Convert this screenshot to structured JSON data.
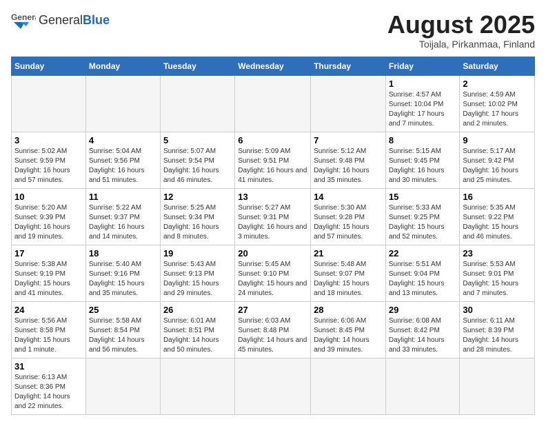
{
  "header": {
    "logo_general": "General",
    "logo_blue": "Blue",
    "month_title": "August 2025",
    "location": "Toijala, Pirkanmaa, Finland"
  },
  "weekdays": [
    "Sunday",
    "Monday",
    "Tuesday",
    "Wednesday",
    "Thursday",
    "Friday",
    "Saturday"
  ],
  "weeks": [
    [
      {
        "day": "",
        "info": ""
      },
      {
        "day": "",
        "info": ""
      },
      {
        "day": "",
        "info": ""
      },
      {
        "day": "",
        "info": ""
      },
      {
        "day": "",
        "info": ""
      },
      {
        "day": "1",
        "info": "Sunrise: 4:57 AM\nSunset: 10:04 PM\nDaylight: 17 hours and 7 minutes."
      },
      {
        "day": "2",
        "info": "Sunrise: 4:59 AM\nSunset: 10:02 PM\nDaylight: 17 hours and 2 minutes."
      }
    ],
    [
      {
        "day": "3",
        "info": "Sunrise: 5:02 AM\nSunset: 9:59 PM\nDaylight: 16 hours and 57 minutes."
      },
      {
        "day": "4",
        "info": "Sunrise: 5:04 AM\nSunset: 9:56 PM\nDaylight: 16 hours and 51 minutes."
      },
      {
        "day": "5",
        "info": "Sunrise: 5:07 AM\nSunset: 9:54 PM\nDaylight: 16 hours and 46 minutes."
      },
      {
        "day": "6",
        "info": "Sunrise: 5:09 AM\nSunset: 9:51 PM\nDaylight: 16 hours and 41 minutes."
      },
      {
        "day": "7",
        "info": "Sunrise: 5:12 AM\nSunset: 9:48 PM\nDaylight: 16 hours and 35 minutes."
      },
      {
        "day": "8",
        "info": "Sunrise: 5:15 AM\nSunset: 9:45 PM\nDaylight: 16 hours and 30 minutes."
      },
      {
        "day": "9",
        "info": "Sunrise: 5:17 AM\nSunset: 9:42 PM\nDaylight: 16 hours and 25 minutes."
      }
    ],
    [
      {
        "day": "10",
        "info": "Sunrise: 5:20 AM\nSunset: 9:39 PM\nDaylight: 16 hours and 19 minutes."
      },
      {
        "day": "11",
        "info": "Sunrise: 5:22 AM\nSunset: 9:37 PM\nDaylight: 16 hours and 14 minutes."
      },
      {
        "day": "12",
        "info": "Sunrise: 5:25 AM\nSunset: 9:34 PM\nDaylight: 16 hours and 8 minutes."
      },
      {
        "day": "13",
        "info": "Sunrise: 5:27 AM\nSunset: 9:31 PM\nDaylight: 16 hours and 3 minutes."
      },
      {
        "day": "14",
        "info": "Sunrise: 5:30 AM\nSunset: 9:28 PM\nDaylight: 15 hours and 57 minutes."
      },
      {
        "day": "15",
        "info": "Sunrise: 5:33 AM\nSunset: 9:25 PM\nDaylight: 15 hours and 52 minutes."
      },
      {
        "day": "16",
        "info": "Sunrise: 5:35 AM\nSunset: 9:22 PM\nDaylight: 15 hours and 46 minutes."
      }
    ],
    [
      {
        "day": "17",
        "info": "Sunrise: 5:38 AM\nSunset: 9:19 PM\nDaylight: 15 hours and 41 minutes."
      },
      {
        "day": "18",
        "info": "Sunrise: 5:40 AM\nSunset: 9:16 PM\nDaylight: 15 hours and 35 minutes."
      },
      {
        "day": "19",
        "info": "Sunrise: 5:43 AM\nSunset: 9:13 PM\nDaylight: 15 hours and 29 minutes."
      },
      {
        "day": "20",
        "info": "Sunrise: 5:45 AM\nSunset: 9:10 PM\nDaylight: 15 hours and 24 minutes."
      },
      {
        "day": "21",
        "info": "Sunrise: 5:48 AM\nSunset: 9:07 PM\nDaylight: 15 hours and 18 minutes."
      },
      {
        "day": "22",
        "info": "Sunrise: 5:51 AM\nSunset: 9:04 PM\nDaylight: 15 hours and 13 minutes."
      },
      {
        "day": "23",
        "info": "Sunrise: 5:53 AM\nSunset: 9:01 PM\nDaylight: 15 hours and 7 minutes."
      }
    ],
    [
      {
        "day": "24",
        "info": "Sunrise: 5:56 AM\nSunset: 8:58 PM\nDaylight: 15 hours and 1 minute."
      },
      {
        "day": "25",
        "info": "Sunrise: 5:58 AM\nSunset: 8:54 PM\nDaylight: 14 hours and 56 minutes."
      },
      {
        "day": "26",
        "info": "Sunrise: 6:01 AM\nSunset: 8:51 PM\nDaylight: 14 hours and 50 minutes."
      },
      {
        "day": "27",
        "info": "Sunrise: 6:03 AM\nSunset: 8:48 PM\nDaylight: 14 hours and 45 minutes."
      },
      {
        "day": "28",
        "info": "Sunrise: 6:06 AM\nSunset: 8:45 PM\nDaylight: 14 hours and 39 minutes."
      },
      {
        "day": "29",
        "info": "Sunrise: 6:08 AM\nSunset: 8:42 PM\nDaylight: 14 hours and 33 minutes."
      },
      {
        "day": "30",
        "info": "Sunrise: 6:11 AM\nSunset: 8:39 PM\nDaylight: 14 hours and 28 minutes."
      }
    ],
    [
      {
        "day": "31",
        "info": "Sunrise: 6:13 AM\nSunset: 8:36 PM\nDaylight: 14 hours and 22 minutes."
      },
      {
        "day": "",
        "info": ""
      },
      {
        "day": "",
        "info": ""
      },
      {
        "day": "",
        "info": ""
      },
      {
        "day": "",
        "info": ""
      },
      {
        "day": "",
        "info": ""
      },
      {
        "day": "",
        "info": ""
      }
    ]
  ]
}
